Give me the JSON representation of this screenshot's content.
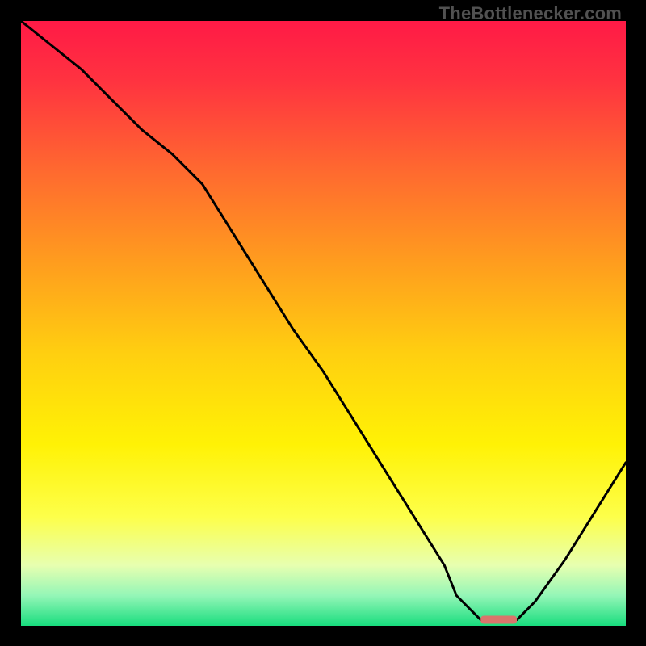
{
  "watermark": "TheBottlenecker.com",
  "chart_data": {
    "type": "line",
    "title": "",
    "xlabel": "",
    "ylabel": "",
    "xlim": [
      0,
      100
    ],
    "ylim": [
      0,
      100
    ],
    "legend": false,
    "grid": false,
    "background": "red-yellow-green-vertical-gradient",
    "series": [
      {
        "name": "bottleneck-curve",
        "x": [
          0,
          5,
          10,
          15,
          20,
          25,
          30,
          35,
          40,
          45,
          50,
          55,
          60,
          65,
          70,
          72,
          76,
          80,
          82,
          85,
          90,
          95,
          100
        ],
        "y": [
          100,
          96,
          92,
          87,
          82,
          78,
          73,
          65,
          57,
          49,
          42,
          34,
          26,
          18,
          10,
          5,
          1,
          1,
          1,
          4,
          11,
          19,
          27
        ]
      }
    ],
    "optimal_marker": {
      "x_start": 76,
      "x_end": 82,
      "y": 1,
      "color": "#d8756b"
    },
    "gradient_stops": [
      {
        "offset": 0.0,
        "color": "#ff1a46"
      },
      {
        "offset": 0.1,
        "color": "#ff3340"
      },
      {
        "offset": 0.25,
        "color": "#ff6a2f"
      },
      {
        "offset": 0.4,
        "color": "#ff9d1e"
      },
      {
        "offset": 0.55,
        "color": "#ffcf10"
      },
      {
        "offset": 0.7,
        "color": "#fff205"
      },
      {
        "offset": 0.82,
        "color": "#fdff4a"
      },
      {
        "offset": 0.9,
        "color": "#e7ffb0"
      },
      {
        "offset": 0.95,
        "color": "#94f6b7"
      },
      {
        "offset": 1.0,
        "color": "#18dd7e"
      }
    ]
  }
}
